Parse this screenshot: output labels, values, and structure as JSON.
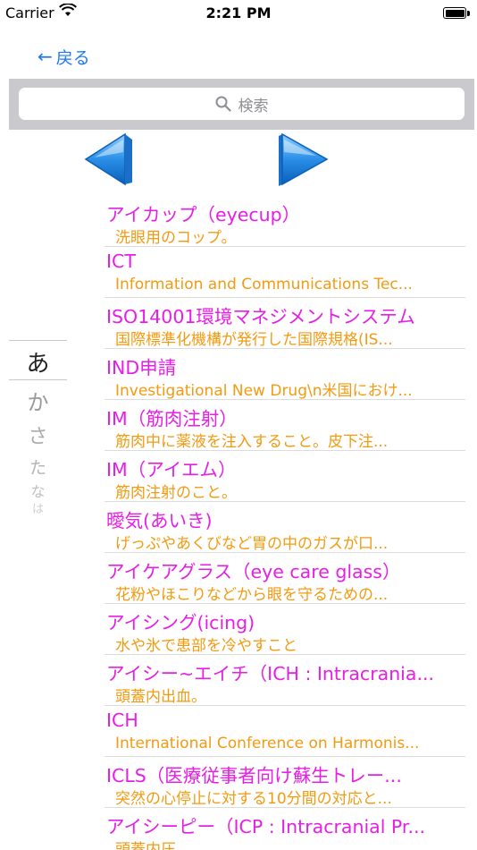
{
  "status_bar": {
    "carrier": "Carrier",
    "time": "2:21 PM",
    "wifi_icon": "wifi-icon",
    "battery_icon": "battery-icon"
  },
  "nav": {
    "back_label": "戻る",
    "back_icon": "left-arrow-icon"
  },
  "search": {
    "placeholder": "検索",
    "icon": "search-icon"
  },
  "arrows": {
    "prev_icon": "triangle-left-icon",
    "next_icon": "triangle-right-icon",
    "color": "#2a8fe8"
  },
  "index": {
    "items": [
      "あ",
      "か",
      "さ",
      "た",
      "な",
      "は"
    ],
    "selected": "あ"
  },
  "colors": {
    "title": "#e61ee6",
    "description": "#f39a10",
    "link": "#1f78f0"
  },
  "entries": [
    {
      "title": "アイカップ（eyecup）",
      "desc": "洗眼用のコップ。"
    },
    {
      "title": "ICT",
      "desc": "Information and Communications Tec..."
    },
    {
      "title": "ISO14001環境マネジメントシステム",
      "desc": "国際標準化機構が発行した国際規格(IS..."
    },
    {
      "title": "IND申請",
      "desc": "Investigational New Drug\\n米国におけ..."
    },
    {
      "title": "IM（筋肉注射）",
      "desc": "筋肉中に薬液を注入すること。皮下注..."
    },
    {
      "title": "IM（アイエム）",
      "desc": "筋肉注射のこと。"
    },
    {
      "title": "曖気(あいき)",
      "desc": "げっぷやあくびなど胃の中のガスが口..."
    },
    {
      "title": "アイケアグラス（eye care glass）",
      "desc": "花粉やほこりなどから眼を守るための..."
    },
    {
      "title": "アイシング(icing)",
      "desc": "水や氷で患部を冷やすこと"
    },
    {
      "title": "アイシー~エイチ（ICH : Intracrania...",
      "desc": "頭蓋内出血。"
    },
    {
      "title": "ICH",
      "desc": "International Conference on Harmonis..."
    },
    {
      "title": "ICLS（医療従事者向け蘇生トレー...",
      "desc": "突然の心停止に対する10分間の対応と..."
    },
    {
      "title": "アイシーピー（ICP : Intracranial Pr...",
      "desc": "頭蓋内圧"
    }
  ]
}
